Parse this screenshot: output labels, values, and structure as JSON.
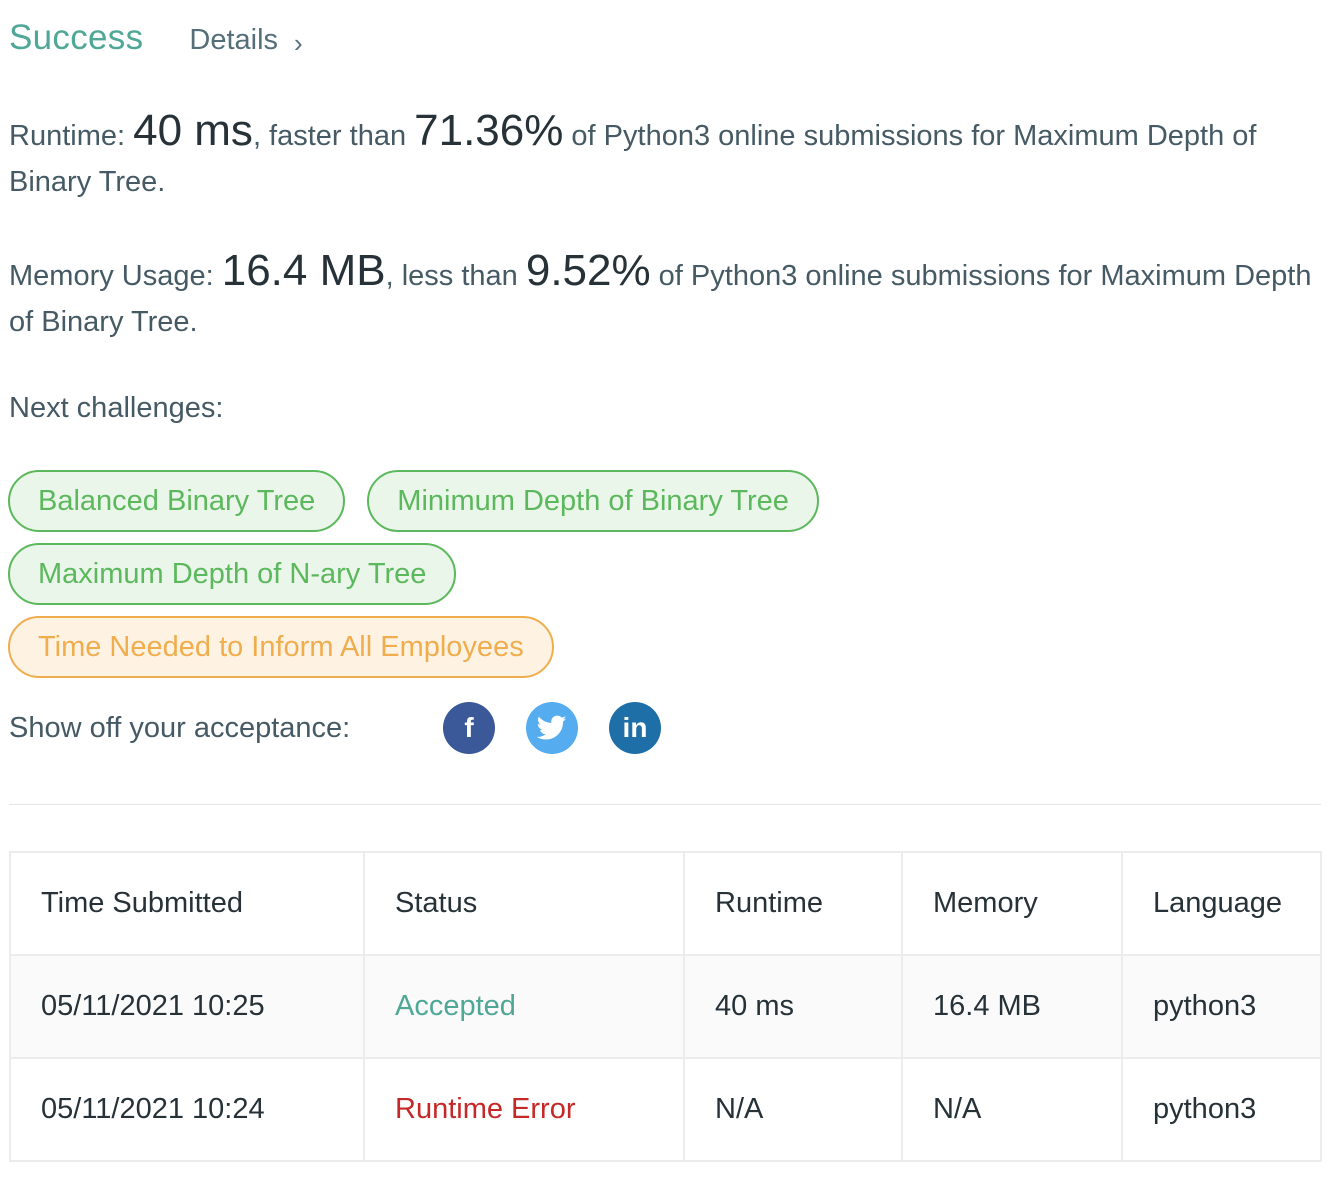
{
  "header": {
    "status": "Success",
    "details_label": "Details",
    "details_chevron": "›"
  },
  "runtime": {
    "label": "Runtime: ",
    "value": "40 ms",
    "mid": ", faster than ",
    "percent": "71.36%",
    "tail": " of Python3 online submissions for Maximum Depth of Binary Tree."
  },
  "memory": {
    "label": "Memory Usage: ",
    "value": "16.4 MB",
    "mid": ", less than ",
    "percent": "9.52%",
    "tail": " of Python3 online submissions for Maximum Depth of Binary Tree."
  },
  "next_challenges": {
    "label": "Next challenges:",
    "items": [
      {
        "label": "Balanced Binary Tree",
        "difficulty": "easy"
      },
      {
        "label": "Minimum Depth of Binary Tree",
        "difficulty": "easy"
      },
      {
        "label": "Maximum Depth of N-ary Tree",
        "difficulty": "easy"
      },
      {
        "label": "Time Needed to Inform All Employees",
        "difficulty": "medium"
      }
    ]
  },
  "share": {
    "label": "Show off your acceptance:",
    "facebook_glyph": "f",
    "linkedin_glyph": "in"
  },
  "table": {
    "headers": [
      "Time Submitted",
      "Status",
      "Runtime",
      "Memory",
      "Language"
    ],
    "rows": [
      {
        "time": "05/11/2021 10:25",
        "status": "Accepted",
        "runtime": "40 ms",
        "memory": "16.4 MB",
        "language": "python3"
      },
      {
        "time": "05/11/2021 10:24",
        "status": "Runtime Error",
        "runtime": "N/A",
        "memory": "N/A",
        "language": "python3"
      }
    ]
  },
  "colors": {
    "success": "#4fa796",
    "easy": "#5cb85c",
    "medium": "#f0ad4e",
    "error": "#c62828",
    "facebook": "#3b5998",
    "twitter": "#55acee",
    "linkedin": "#1e6ea7"
  }
}
